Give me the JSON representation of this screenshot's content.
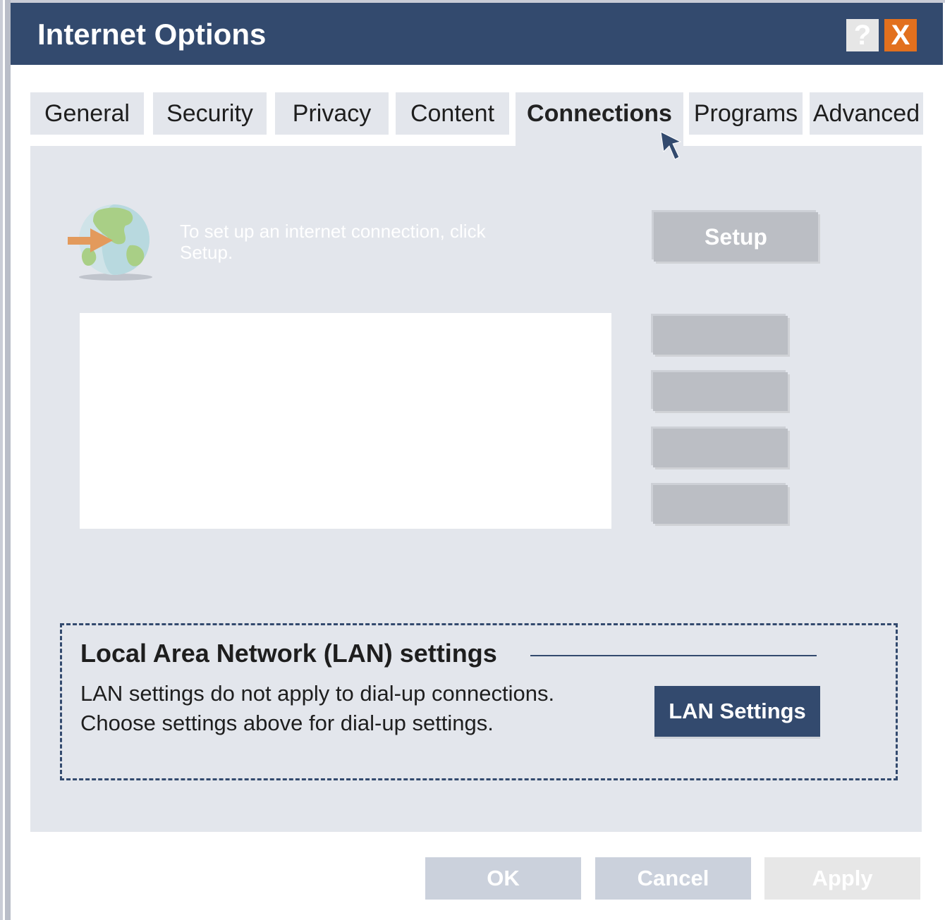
{
  "window": {
    "title": "Internet Options",
    "help_label": "?",
    "close_label": "X",
    "title_bar_color": "#334a6e",
    "close_button_color": "#e2701e"
  },
  "tabs": [
    {
      "label": "General",
      "active": false
    },
    {
      "label": "Security",
      "active": false
    },
    {
      "label": "Privacy",
      "active": false
    },
    {
      "label": "Content",
      "active": false
    },
    {
      "label": "Connections",
      "active": true
    },
    {
      "label": "Programs",
      "active": false
    },
    {
      "label": "Advanced",
      "active": false
    }
  ],
  "connections": {
    "icon": "globe-arrow-icon",
    "setup_text": "To set up an internet connection, click Setup.",
    "setup_button": "Setup",
    "dialup_list": [],
    "side_buttons": [
      "",
      "",
      "",
      ""
    ]
  },
  "lan": {
    "heading": "Local Area Network (LAN) settings",
    "line1": "LAN settings do not apply to dial-up connections.",
    "line2": "Choose settings above for dial-up settings.",
    "button": "LAN Settings"
  },
  "footer": {
    "ok": "OK",
    "cancel": "Cancel",
    "apply": "Apply"
  },
  "cursor_icon": "mouse-pointer-icon"
}
